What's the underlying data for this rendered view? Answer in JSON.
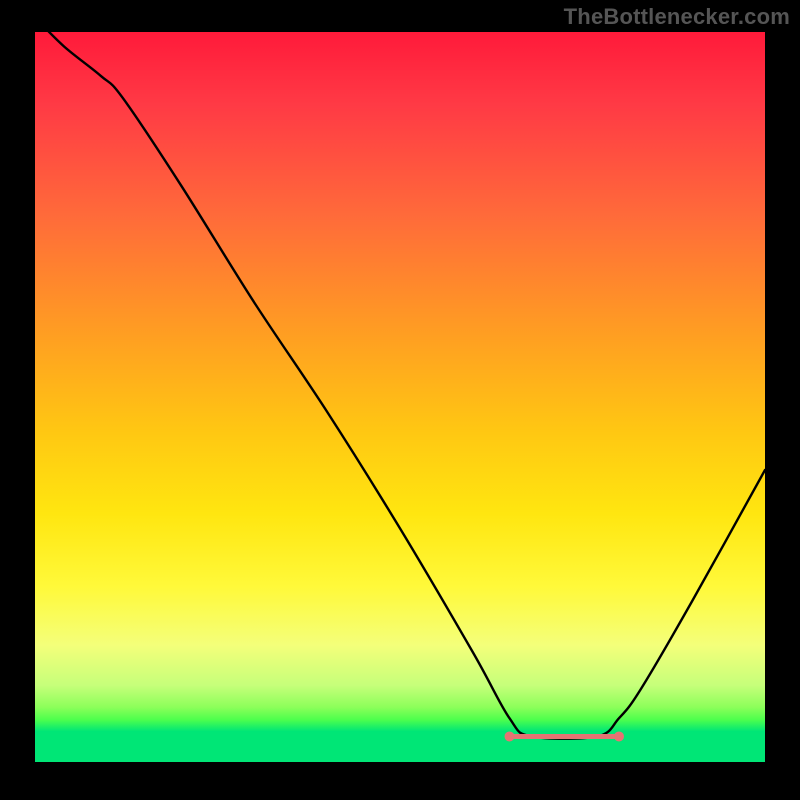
{
  "source_label": "TheBottlenecker.com",
  "chart_data": {
    "type": "line",
    "title": "",
    "xlabel": "",
    "ylabel": "",
    "xlim": [
      0,
      100
    ],
    "ylim": [
      0,
      100
    ],
    "series": [
      {
        "name": "bottleneck-curve",
        "x": [
          0,
          4,
          9,
          12,
          20,
          30,
          40,
          50,
          60,
          65,
          68,
          77,
          80,
          83,
          90,
          100
        ],
        "values": [
          102,
          98,
          94,
          91,
          79,
          63,
          48,
          32,
          15,
          6,
          3.5,
          3.5,
          6,
          10,
          22,
          40
        ]
      }
    ],
    "plateau": {
      "x_start": 65,
      "x_end": 80,
      "y": 3.5,
      "color": "#e57373",
      "endpoint_radius_px": 5,
      "stroke_width_px": 5
    },
    "colors": {
      "curve_stroke": "#000000",
      "plateau_stroke": "#e57373",
      "background_top": "#ff1a3a",
      "background_bottom": "#00e676",
      "frame": "#000000"
    }
  }
}
